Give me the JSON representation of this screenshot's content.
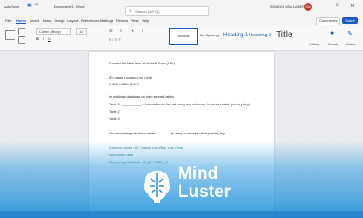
{
  "window": {
    "autosave_label": "AutoSave",
    "doc_title": "Document1 - Word",
    "search_placeholder": "Search (Alt+Q)",
    "user_name": "SHADID WALLADEN",
    "avatar_initials": "SW"
  },
  "tabs": [
    "File",
    "Home",
    "Insert",
    "Draw",
    "Design",
    "Layout",
    "References",
    "Mailings",
    "Review",
    "View",
    "Help"
  ],
  "tab_buttons": {
    "comments": "Comments",
    "share": "Share"
  },
  "ribbon": {
    "font_name": "Calibri (Body)",
    "font_size": "11",
    "styles": [
      "Normal",
      "No Spacing",
      "Heading 1",
      "Heading 2",
      "Title"
    ],
    "editing_label": "Editing",
    "dictate_label": "Dictate",
    "editor_label": "Editor"
  },
  "document": {
    "lines": [
      "Convert this table into 1st Normal Form (1NF).",
      "ID   • name   Location   Lvm   Certu",
      "1      ABC    XMBC    UPA    K",
      "In relational database we have several tables",
      "Table 1 :___________ = Information to the null many and columns : Important value (primary key)",
      "Table 2",
      "Table 3",
      "You must design all those tables ———— by using a concept called primary key",
      "Columns values : ID, l_name, Locn/Key, Lvm, Certu",
      "Employees Table",
      "Primary Key for Table = E_NO, DEPT_ID"
    ]
  },
  "overlay": {
    "logo_line1": "Mind",
    "logo_line2": "Luster"
  },
  "icons": [
    "search-icon",
    "save-icon",
    "undo-icon",
    "minimize-icon",
    "maximize-icon",
    "close-icon",
    "brain-icon"
  ]
}
